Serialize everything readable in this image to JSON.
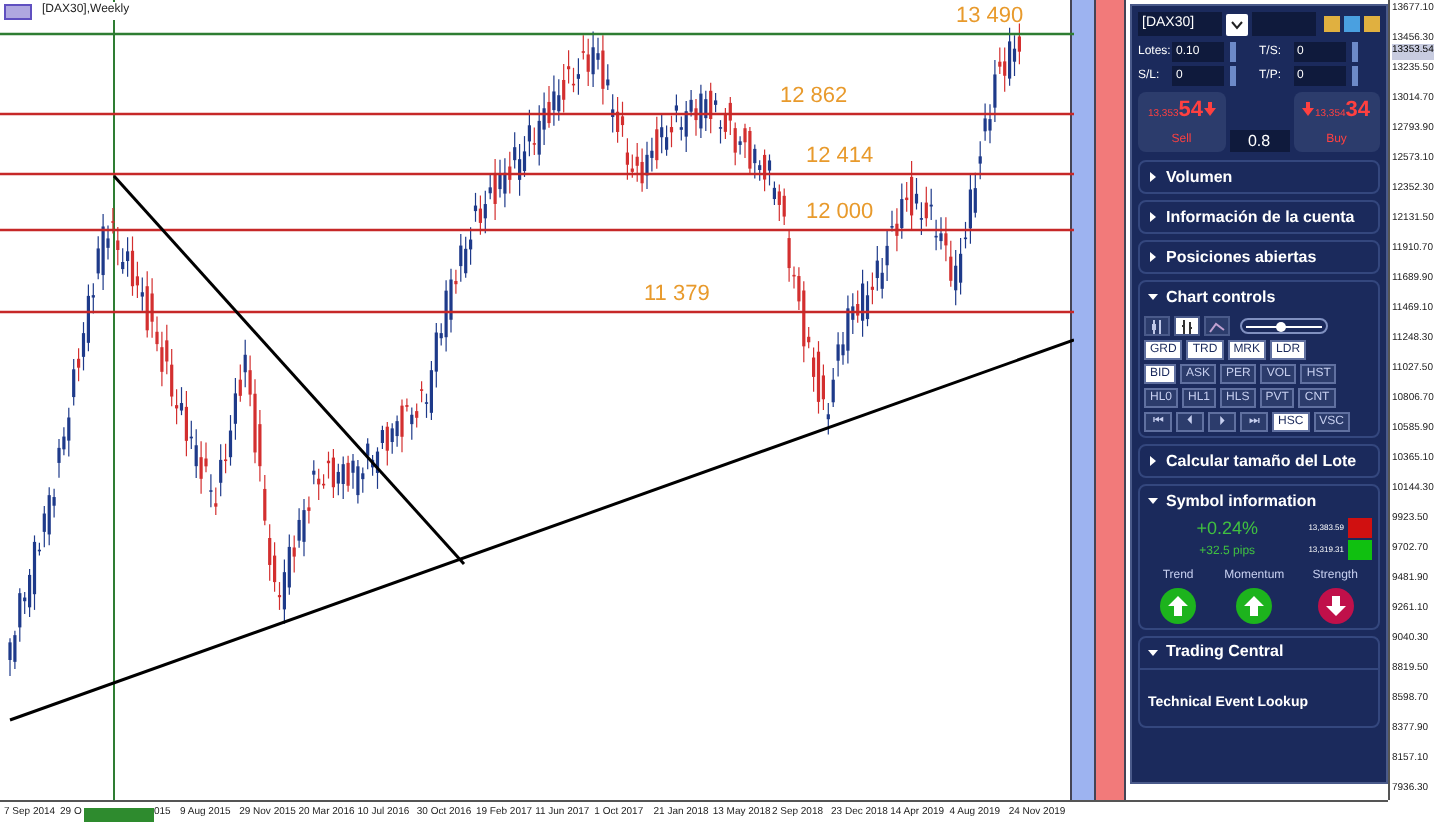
{
  "chart": {
    "title": "[DAX30],Weekly",
    "levels": [
      {
        "label": "13 490",
        "kind": "target"
      },
      {
        "label": "12 862",
        "kind": "resistance"
      },
      {
        "label": "12 414",
        "kind": "resistance"
      },
      {
        "label": "12 000",
        "kind": "resistance"
      },
      {
        "label": "11 379",
        "kind": "resistance"
      }
    ],
    "price_axis": [
      "13677.10",
      "13456.30",
      "13235.50",
      "13014.70",
      "12793.90",
      "12573.10",
      "12352.30",
      "12131.50",
      "11910.70",
      "11689.90",
      "11469.10",
      "11248.30",
      "11027.50",
      "10806.70",
      "10585.90",
      "10365.10",
      "10144.30",
      "9923.50",
      "9702.70",
      "9481.90",
      "9261.10",
      "9040.30",
      "8819.50",
      "8598.70",
      "8377.90",
      "8157.10",
      "7936.30"
    ],
    "current_price": "13353.54",
    "time_axis": [
      "7 Sep 2014",
      "29 O",
      "015",
      "9 Aug 2015",
      "29 Nov 2015",
      "20 Mar 2016",
      "10 Jul 2016",
      "30 Oct 2016",
      "19 Feb 2017",
      "11 Jun 2017",
      "1 Oct 2017",
      "21 Jan 2018",
      "13 May 2018",
      "2 Sep 2018",
      "23 Dec 2018",
      "14 Apr 2019",
      "4 Aug 2019",
      "24 Nov 2019"
    ]
  },
  "panel": {
    "symbol": "[DAX30]",
    "fields": [
      {
        "label": "Lotes:",
        "value": "0.10"
      },
      {
        "label": "T/S:",
        "value": "0"
      },
      {
        "label": "S/L:",
        "value": "0"
      },
      {
        "label": "T/P:",
        "value": "0"
      }
    ],
    "sell": {
      "price": "13,353",
      "pips": "54",
      "label": "Sell"
    },
    "buy": {
      "price": "13,354",
      "pips": "34",
      "label": "Buy"
    },
    "spread": "0.8",
    "sections_top": [
      {
        "title": "Volumen",
        "expanded": false
      },
      {
        "title": "Información de la cuenta",
        "expanded": false
      },
      {
        "title": "Posiciones abiertas",
        "expanded": false
      }
    ],
    "chart_controls": {
      "title": "Chart controls",
      "expanded": true,
      "icon_buttons": [
        {
          "kind": "candles",
          "selected": false
        },
        {
          "kind": "bars",
          "selected": true
        },
        {
          "kind": "line",
          "selected": false
        }
      ],
      "zoom": {
        "level": 0.45
      },
      "rows": [
        [
          {
            "label": "GRD",
            "selected": true
          },
          {
            "label": "TRD",
            "selected": true
          },
          {
            "label": "MRK",
            "selected": true
          },
          {
            "label": "LDR",
            "selected": true
          }
        ],
        [
          {
            "label": "BID",
            "selected": true
          },
          {
            "label": "ASK",
            "selected": false
          },
          {
            "label": "PER",
            "selected": false
          },
          {
            "label": "VOL",
            "selected": false
          },
          {
            "label": "HST",
            "selected": false
          }
        ],
        [
          {
            "label": "HL0",
            "selected": false
          },
          {
            "label": "HL1",
            "selected": false
          },
          {
            "label": "HLS",
            "selected": false
          },
          {
            "label": "PVT",
            "selected": false
          },
          {
            "label": "CNT",
            "selected": false
          }
        ],
        [
          {
            "label": "⏮",
            "selected": false
          },
          {
            "label": "⏴",
            "selected": false
          },
          {
            "label": "⏵",
            "selected": false
          },
          {
            "label": "⏭",
            "selected": false
          },
          {
            "label": "HSC",
            "selected": true
          },
          {
            "label": "VSC",
            "selected": false
          }
        ]
      ]
    },
    "lot_calc": {
      "title": "Calcular tamaño del Lote",
      "expanded": false
    },
    "symbol_info": {
      "title": "Symbol information",
      "expanded": true,
      "change": "+0.24%",
      "pips": "+32.5 pips",
      "high": "13,383.59",
      "low": "13,319.31",
      "signals": [
        {
          "label": "Trend",
          "kind": "up"
        },
        {
          "label": "Momentum",
          "kind": "up"
        },
        {
          "label": "Strength",
          "kind": "down"
        }
      ]
    },
    "trading_central": {
      "title": "Trading Central",
      "expanded": true,
      "item": "Technical Event Lookup"
    }
  }
}
